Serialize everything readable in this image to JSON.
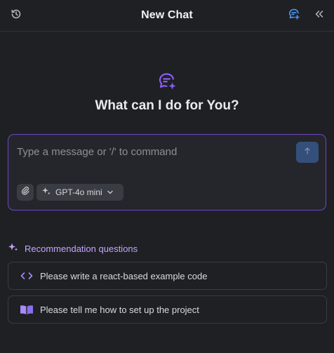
{
  "header": {
    "title": "New Chat",
    "history_icon": "history-icon",
    "new_chat_icon": "new-chat-icon",
    "collapse_icon": "double-chevron-left-icon"
  },
  "hero": {
    "icon": "chat-sparkle-icon",
    "title": "What can I do for You?"
  },
  "composer": {
    "placeholder": "Type a message or '/' to command",
    "send_icon": "arrow-up-icon",
    "attach_icon": "paperclip-icon",
    "model": {
      "icon": "sparkle-icon",
      "selected": "GPT-4o mini",
      "chevron_icon": "chevron-down-icon"
    }
  },
  "recommendations": {
    "title": "Recommendation questions",
    "icon": "sparkle-icon",
    "items": [
      {
        "icon": "code-icon",
        "label": "Please write a react-based example code"
      },
      {
        "icon": "book-icon",
        "label": "Please tell me how to set up the project"
      }
    ]
  },
  "colors": {
    "background": "#1f2024",
    "accent_purple": "#8b5cf6",
    "accent_blue": "#3b82f6",
    "border": "#3a3c43"
  }
}
